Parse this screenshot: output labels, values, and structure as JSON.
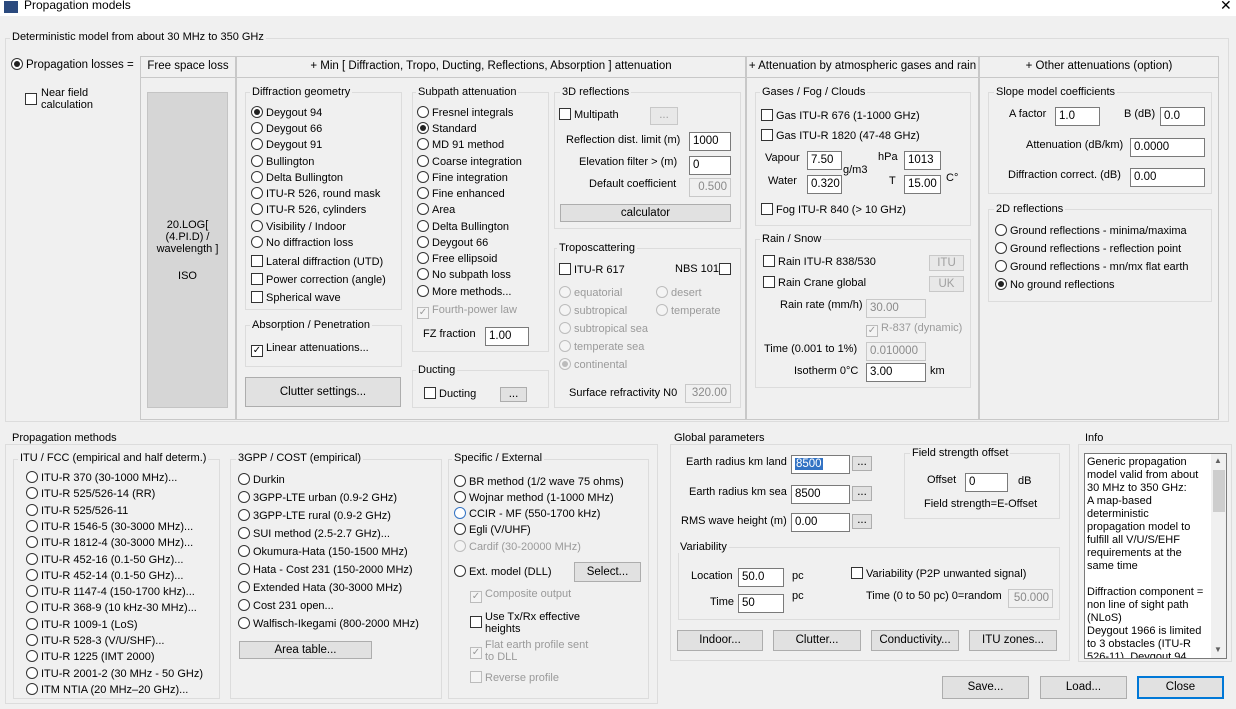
{
  "window": {
    "title": "Propagation models",
    "close": "✕"
  },
  "det": {
    "title": "Deterministic model from about 30 MHz to 350 GHz",
    "prop_losses": "Propagation losses =",
    "near_field": "Near field calculation",
    "headers": {
      "fsl": "Free space loss",
      "min": "+ Min [ Diffraction, Tropo, Ducting, Reflections, Absorption ] attenuation",
      "atm": "+ Attenuation by atmospheric gases and rain",
      "other": "+ Other attenuations (option)"
    },
    "fsl_formula": "20.LOG[ (4.PI.D) / wavelength ]",
    "fsl_std": "ISO"
  },
  "diffraction": {
    "title": "Diffraction geometry",
    "options": [
      "Deygout 94",
      "Deygout 66",
      "Deygout 91",
      "Bullington",
      "Delta Bullington",
      "ITU-R 526, round mask",
      "ITU-R 526, cylinders",
      "Visibility / Indoor",
      "No diffraction loss"
    ],
    "lateral": "Lateral diffraction (UTD)",
    "power_corr": "Power correction (angle)",
    "spherical": "Spherical wave"
  },
  "absorption": {
    "title": "Absorption / Penetration",
    "linear": "Linear attenuations...",
    "check": "✓"
  },
  "clutter_btn": "Clutter settings...",
  "subpath": {
    "title": "Subpath attenuation",
    "options": [
      "Fresnel integrals",
      "Standard",
      "MD 91 method",
      "Coarse integration",
      "Fine integration",
      "Fine enhanced",
      "Area",
      "Delta Bullington",
      "Deygout 66",
      "Free ellipsoid",
      "No subpath loss",
      "More methods..."
    ],
    "fourth": "Fourth-power law",
    "check": "✓",
    "fz_label": "FZ fraction",
    "fz": "1.00"
  },
  "ducting": {
    "title": "Ducting",
    "label": "Ducting",
    "btn": "..."
  },
  "refl3d": {
    "title": "3D reflections",
    "multipath": "Multipath",
    "btn": "...",
    "refl_dist_label": "Reflection dist. limit (m)",
    "refl_dist": "1000",
    "elev_label": "Elevation filter > (m)",
    "elev": "0",
    "coef_label": "Default coefficient",
    "coef": "0.500",
    "calc": "calculator"
  },
  "tropo": {
    "title": "Troposcattering",
    "itu": "ITU-R 617",
    "nbs": "NBS 101",
    "climates": [
      "equatorial",
      "desert",
      "subtropical",
      "temperate",
      "subtropical sea",
      "temperate sea",
      "continental"
    ],
    "n0_label": "Surface refractivity N0",
    "n0": "320.00"
  },
  "gases": {
    "title": "Gases / Fog / Clouds",
    "itu676": "Gas ITU-R 676 (1-1000 GHz)",
    "itu1820": "Gas ITU-R 1820 (47-48 GHz)",
    "vapour_label": "Vapour",
    "vapour": "7.50",
    "water_label": "Water",
    "water": "0.320",
    "unit_gm3": "g/m3",
    "hpa_label": "hPa",
    "hpa": "1013",
    "t_label": "T",
    "t": "15.00",
    "deg": "C°",
    "fog": "Fog ITU-R 840 (> 10 GHz)"
  },
  "rain": {
    "title": "Rain / Snow",
    "itu838": "Rain ITU-R 838/530",
    "itu_btn": "ITU",
    "crane": "Rain Crane global",
    "uk_btn": "UK",
    "rate_label": "Rain rate (mm/h)",
    "rate": "30.00",
    "r837": "R-837 (dynamic)",
    "check": "✓",
    "time_label": "Time (0.001 to 1%)",
    "time": "0.010000",
    "iso_label": "Isotherm 0°C",
    "iso": "3.00",
    "km": "km"
  },
  "slope": {
    "title": "Slope model coefficients",
    "a_label": "A factor",
    "a": "1.0",
    "b_label": "B (dB)",
    "b": "0.0",
    "att_label": "Attenuation (dB/km)",
    "att": "0.0000",
    "diff_label": "Diffraction correct. (dB)",
    "diff": "0.00"
  },
  "refl2d": {
    "title": "2D reflections",
    "options": [
      "Ground reflections - minima/maxima",
      "Ground reflections - reflection point",
      "Ground reflections - mn/mx flat earth",
      "No ground reflections"
    ]
  },
  "methods": {
    "title": "Propagation methods",
    "itu_title": "ITU / FCC (empirical and half determ.)",
    "itu": [
      "ITU-R 370 (30-1000 MHz)...",
      "ITU-R 525/526-14 (RR)",
      "ITU-R 525/526-11",
      "ITU-R 1546-5 (30-3000 MHz)...",
      "ITU-R 1812-4 (30-3000 MHz)...",
      "ITU-R 452-16 (0.1-50 GHz)...",
      "ITU-R 452-14 (0.1-50 GHz)...",
      "ITU-R 1147-4 (150-1700 kHz)...",
      "ITU-R 368-9 (10 kHz-30 MHz)...",
      "ITU-R 1009-1 (LoS)",
      "ITU-R 528-3 (V/U/SHF)...",
      "ITU-R 1225 (IMT 2000)",
      "ITU-R 2001-2 (30 MHz - 50 GHz)",
      "ITM NTIA (20 MHz–20 GHz)..."
    ],
    "gpp_title": "3GPP / COST (empirical)",
    "gpp": [
      "Durkin",
      "3GPP-LTE urban (0.9-2 GHz)",
      "3GPP-LTE rural (0.9-2 GHz)",
      "SUI method (2.5-2.7 GHz)...",
      "Okumura-Hata (150-1500 MHz)",
      "Hata - Cost 231 (150-2000 MHz)",
      "Extended Hata (30-3000 MHz)",
      "Cost 231 open...",
      "Walfisch-Ikegami (800-2000 MHz)"
    ],
    "area_btn": "Area table...",
    "ext_title": "Specific / External",
    "ext": [
      "BR method (1/2 wave 75 ohms)",
      "Wojnar method (1-1000 MHz)",
      "CCIR - MF (550-1700 kHz)",
      "Egli (V/UHF)",
      "Cardif (30-20000 MHz)"
    ],
    "dll": "Ext. model (DLL)",
    "select_btn": "Select...",
    "composite": "Composite output",
    "txrx": "Use Tx/Rx effective heights",
    "flat": "Flat earth profile sent to DLL",
    "reverse": "Reverse profile",
    "check": "✓"
  },
  "global": {
    "title": "Global parameters",
    "land_label": "Earth radius km land",
    "land": "8500",
    "sea_label": "Earth radius km sea",
    "sea": "8500",
    "rms_label": "RMS wave height (m)",
    "rms": "0.00",
    "btn": "..."
  },
  "fso": {
    "title": "Field strength offset",
    "offset_label": "Offset",
    "offset": "0",
    "db": "dB",
    "formula": "Field strength=E-Offset"
  },
  "variability": {
    "title": "Variability",
    "loc_label": "Location",
    "loc": "50.0",
    "pc": "pc",
    "time_label": "Time",
    "time": "50",
    "p2p": "Variability (P2P unwanted signal)",
    "time_range": "Time (0 to 50 pc) 0=random",
    "time_val": "50.000"
  },
  "bottom_btns": [
    "Indoor...",
    "Clutter...",
    "Conductivity...",
    "ITU zones..."
  ],
  "info": {
    "title": "Info",
    "text": "Generic propagation model valid from about 30 MHz to 350 GHz:\nA map-based deterministic propagation model to fulfill all V/U/S/EHF requirements at the same time\n\nDiffraction component = non line of sight path (NLoS)\nDeygout 1966 is limited to 3 obstacles (ITU-R 526-11). Deygout 94",
    "up": "▲",
    "down": "▼"
  },
  "footer": {
    "save": "Save...",
    "load": "Load...",
    "close": "Close"
  }
}
